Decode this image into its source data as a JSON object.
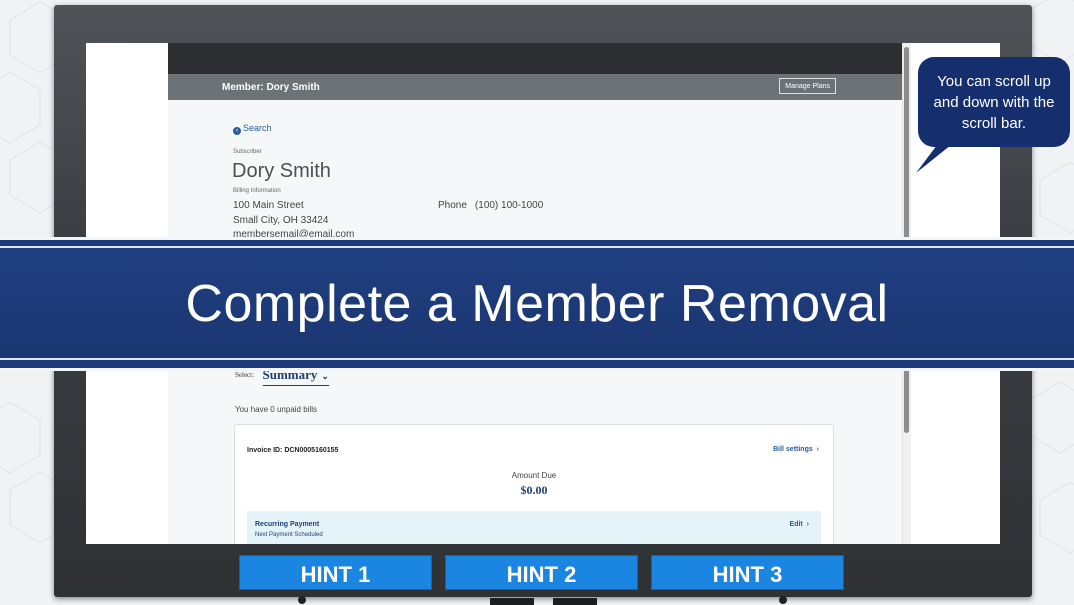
{
  "member_bar": {
    "title": "Member: Dory Smith",
    "manage_plans": "Manage Plans"
  },
  "search": {
    "label": "Search"
  },
  "subscriber": {
    "section_label": "Subscriber",
    "name": "Dory Smith",
    "billing_label": "Billing Information",
    "street": "100 Main Street",
    "city": "Small City, OH 33424",
    "email": "membersemail@email.com",
    "phone_label": "Phone",
    "phone": "(100) 100-1000"
  },
  "select": {
    "label": "Select:",
    "value": "Summary"
  },
  "bills": {
    "unpaid_text": "You have 0 unpaid bills"
  },
  "invoice": {
    "id_text": "Invoice ID: DCN0005160155",
    "bill_settings": "Bill settings",
    "amount_label": "Amount Due",
    "amount_value": "$0.00",
    "recurring_title": "Recurring Payment",
    "recurring_sub": "Next Payment Scheduled",
    "edit": "Edit"
  },
  "banner": {
    "title": "Complete a Member Removal"
  },
  "callout": {
    "text": "You can scroll up and down with the scroll bar."
  },
  "hints": [
    "HINT 1",
    "HINT 2",
    "HINT 3"
  ],
  "icons": {
    "search": "circle-chevron-left-icon",
    "chevron": "chevron-right-icon",
    "dropdown": "chevron-down-icon"
  },
  "colors": {
    "banner": "#1d3b7a",
    "hint_button": "#1a86e2",
    "callout": "#152f6e",
    "link": "#2a5d9c"
  }
}
